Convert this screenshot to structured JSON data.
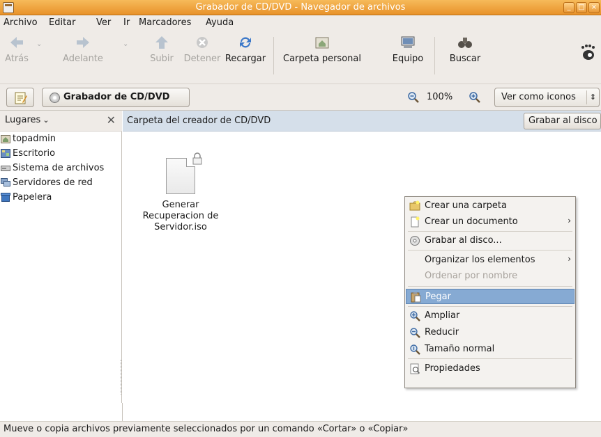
{
  "window": {
    "title": "Grabador de CD/DVD - Navegador de archivos",
    "buttons": [
      "_",
      "□",
      "×"
    ]
  },
  "menubar": [
    "Archivo",
    "Editar",
    "Ver",
    "Ir",
    "Marcadores",
    "Ayuda"
  ],
  "toolbar": {
    "back": "Atrás",
    "forward": "Adelante",
    "up": "Subir",
    "stop": "Detener",
    "reload": "Recargar",
    "home": "Carpeta personal",
    "computer": "Equipo",
    "search": "Buscar"
  },
  "location": {
    "crumb": "Grabador de CD/DVD",
    "zoom": "100%",
    "view_mode": "Ver como iconos",
    "view_arrow": "⇕"
  },
  "sidebar": {
    "header": "Lugares",
    "header_arrow": "⌄",
    "close": "✕",
    "items": [
      {
        "label": "topadmin",
        "icon": "home-folder-icon"
      },
      {
        "label": "Escritorio",
        "icon": "desktop-icon"
      },
      {
        "label": "Sistema de archivos",
        "icon": "drive-icon"
      },
      {
        "label": "Servidores de red",
        "icon": "network-icon"
      },
      {
        "label": "Papelera",
        "icon": "trash-icon"
      }
    ]
  },
  "main": {
    "banner": "Carpeta del creador de CD/DVD",
    "burn_button": "Grabar al disco",
    "files": [
      {
        "name_lines": [
          "Generar",
          "Recuperacion de",
          "Servidor.iso"
        ],
        "icon": "iso-file-icon"
      }
    ]
  },
  "context_menu": {
    "items": [
      {
        "label": "Crear una carpeta",
        "icon": "new-folder-icon",
        "submenu": false,
        "disabled": false
      },
      {
        "label": "Crear un documento",
        "icon": "new-document-icon",
        "submenu": true,
        "disabled": false
      },
      {
        "label": "Grabar al disco...",
        "icon": "disc-icon",
        "submenu": false,
        "disabled": false
      },
      {
        "label": "Organizar los elementos",
        "icon": "",
        "submenu": true,
        "disabled": false
      },
      {
        "label": "Ordenar por nombre",
        "icon": "",
        "submenu": false,
        "disabled": true
      },
      {
        "label": "Pegar",
        "icon": "paste-icon",
        "submenu": false,
        "disabled": false,
        "active": true
      },
      {
        "label": "Ampliar",
        "icon": "zoom-in-icon",
        "submenu": false,
        "disabled": false
      },
      {
        "label": "Reducir",
        "icon": "zoom-out-icon",
        "submenu": false,
        "disabled": false
      },
      {
        "label": "Tamaño normal",
        "icon": "zoom-normal-icon",
        "submenu": false,
        "disabled": false
      },
      {
        "label": "Propiedades",
        "icon": "properties-icon",
        "submenu": false,
        "disabled": false
      }
    ],
    "submenu_glyph": "›"
  },
  "status": "Mueve o copia archivos previamente seleccionados por un comando «Cortar» o «Copiar»",
  "colors": {
    "titlebar": "#e8922a",
    "banner": "#d5dfea",
    "menu_highlight": "#86aad3"
  }
}
